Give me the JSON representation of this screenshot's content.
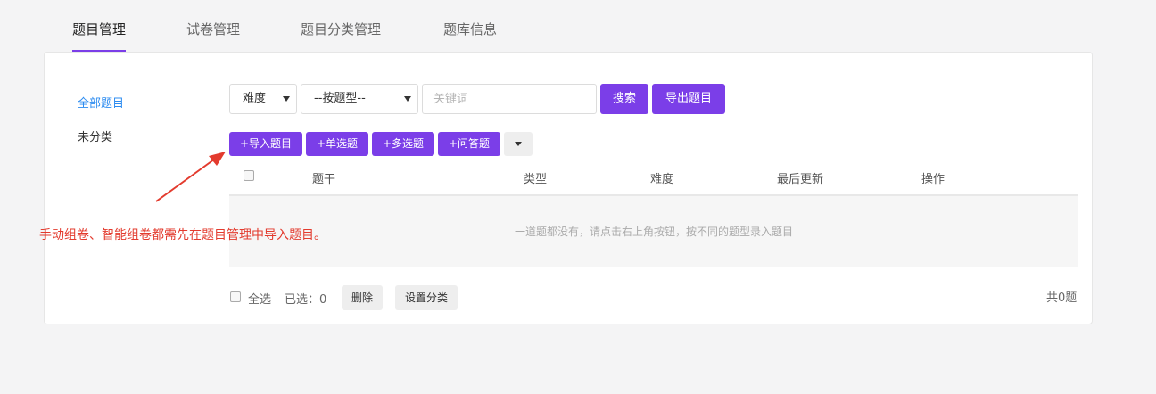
{
  "nav": {
    "tabs": [
      {
        "label": "题目管理",
        "active": true
      },
      {
        "label": "试卷管理",
        "active": false
      },
      {
        "label": "题目分类管理",
        "active": false
      },
      {
        "label": "题库信息",
        "active": false
      }
    ]
  },
  "sidebar": {
    "items": [
      {
        "label": "全部题目",
        "active": true
      },
      {
        "label": "未分类",
        "active": false
      }
    ]
  },
  "filters": {
    "difficulty_select": "难度",
    "type_select": "--按题型--",
    "keyword_placeholder": "关键词",
    "search_label": "搜索",
    "export_label": "导出题目"
  },
  "actions": {
    "import_label": "+导入题目",
    "single_choice_label": "+单选题",
    "multi_choice_label": "+多选题",
    "qa_label": "+问答题"
  },
  "table": {
    "columns": [
      "题干",
      "类型",
      "难度",
      "最后更新",
      "操作"
    ],
    "empty_text": "一道题都没有，请点击右上角按钮，按不同的题型录入题目"
  },
  "footer": {
    "select_all_label": "全选",
    "selected_prefix": "已选：",
    "selected_count": "0",
    "delete_label": "删除",
    "set_category_label": "设置分类",
    "total_text": "共0题"
  },
  "annotation": {
    "text": "手动组卷、智能组卷都需先在题目管理中导入题目。"
  },
  "colors": {
    "accent": "#7b3ee8",
    "link_active": "#2d8cf0",
    "annotation": "#e33b2e"
  }
}
